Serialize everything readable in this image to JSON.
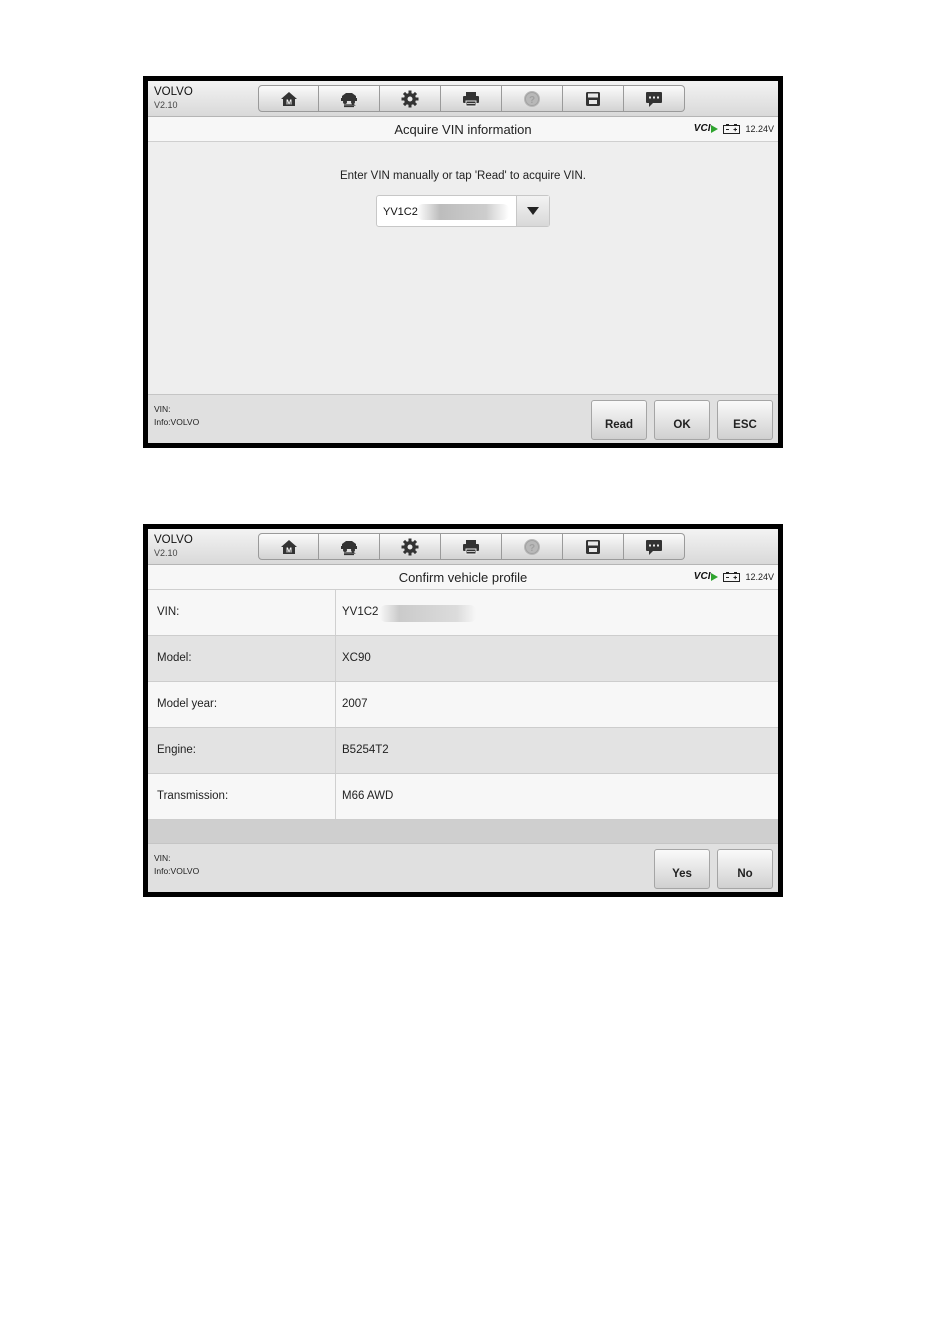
{
  "screen1": {
    "brand": "VOLVO",
    "version": "V2.10",
    "toolbar_icons": [
      "home-m-icon",
      "vehicle-swap-icon",
      "gear-icon",
      "printer-icon",
      "help-icon",
      "save-icon",
      "message-icon"
    ],
    "title": "Acquire VIN information",
    "vci_label": "VCI",
    "voltage": "12.24V",
    "prompt": "Enter VIN manually or tap 'Read' to acquire VIN.",
    "vin_value": "YV1C2",
    "info_vin": "VIN:",
    "info_text": "Info:VOLVO",
    "buttons": {
      "read": "Read",
      "ok": "OK",
      "esc": "ESC"
    }
  },
  "screen2": {
    "brand": "VOLVO",
    "version": "V2.10",
    "title": "Confirm vehicle profile",
    "vci_label": "VCI",
    "voltage": "12.24V",
    "rows": [
      {
        "label": "VIN:",
        "value": "YV1C2"
      },
      {
        "label": "Model:",
        "value": "XC90"
      },
      {
        "label": "Model year:",
        "value": "2007"
      },
      {
        "label": "Engine:",
        "value": "B5254T2"
      },
      {
        "label": "Transmission:",
        "value": "M66 AWD"
      }
    ],
    "info_vin": "VIN:",
    "info_text": "Info:VOLVO",
    "buttons": {
      "yes": "Yes",
      "no": "No"
    }
  }
}
